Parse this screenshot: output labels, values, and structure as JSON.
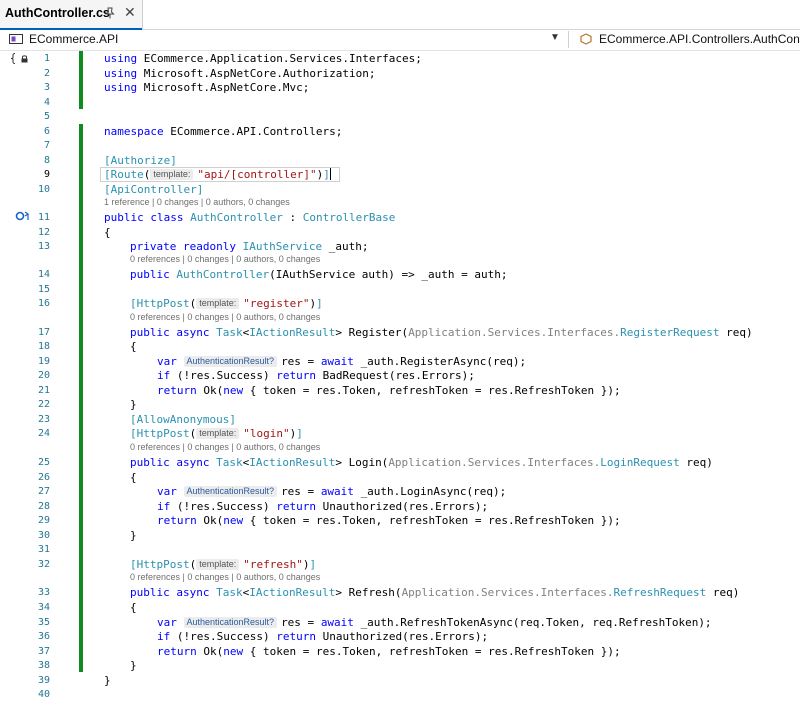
{
  "tab": {
    "title": "AuthController.cs"
  },
  "nav": {
    "project": "ECommerce.API",
    "class_path": "ECommerce.API.Controllers.AuthControll"
  },
  "code": {
    "using1": "ECommerce.Application.Services.Interfaces;",
    "using2": "Microsoft.AspNetCore.Authorization;",
    "using3": "Microsoft.AspNetCore.Mvc;",
    "namespace_name": "ECommerce.API.Controllers;",
    "attr_authorize": "[Authorize]",
    "attr_route_name": "Route",
    "route_value": "\"api/[controller]\"",
    "attr_apicontroller": "[ApiController]",
    "class_name": "AuthController",
    "base_class": "ControllerBase",
    "field_type": "IAuthService",
    "field_name": "_auth",
    "ctor_rest": "(IAuthService auth) => _auth = auth;",
    "register_route": "\"register\"",
    "login_route": "\"login\"",
    "refresh_route": "\"refresh\"",
    "ns_prefix": "Application.Services.Interfaces.",
    "register_request": "RegisterRequest",
    "login_request": "LoginRequest",
    "refresh_request": "RefreshRequest",
    "register_call": "_auth.RegisterAsync(req);",
    "login_call": "_auth.LoginAsync(req);",
    "refresh_call": "_auth.RefreshTokenAsync(req.Token, req.RefreshToken);",
    "bad_request": "BadRequest(res.Errors);",
    "unauthorized": "Unauthorized(res.Errors);",
    "ok_rest": "{ token = res.Token, refreshToken = res.RefreshToken });",
    "allow_anonymous": "[AllowAnonymous]",
    "hint_template": "template:",
    "hint_authresult": "AuthenticationResult?",
    "open_brace": "{",
    "close_brace": "}"
  },
  "lens": {
    "class": "1 reference | 0 changes | 0 authors, 0 changes",
    "zero": "0 references | 0 changes | 0 authors, 0 changes"
  },
  "line_numbers": [
    "1",
    "2",
    "3",
    "4",
    "5",
    "6",
    "7",
    "8",
    "9",
    "10",
    "11",
    "12",
    "13",
    "14",
    "15",
    "16",
    "17",
    "18",
    "19",
    "20",
    "21",
    "22",
    "23",
    "24",
    "25",
    "26",
    "27",
    "28",
    "29",
    "30",
    "31",
    "32",
    "33",
    "34",
    "35",
    "36",
    "37",
    "38",
    "39",
    "40"
  ],
  "colors": {
    "keyword": "#0000ff",
    "type": "#2b91af",
    "string": "#a31515",
    "line_number": "#237893",
    "change_bar": "#108c1f",
    "accent": "#005fb8"
  }
}
